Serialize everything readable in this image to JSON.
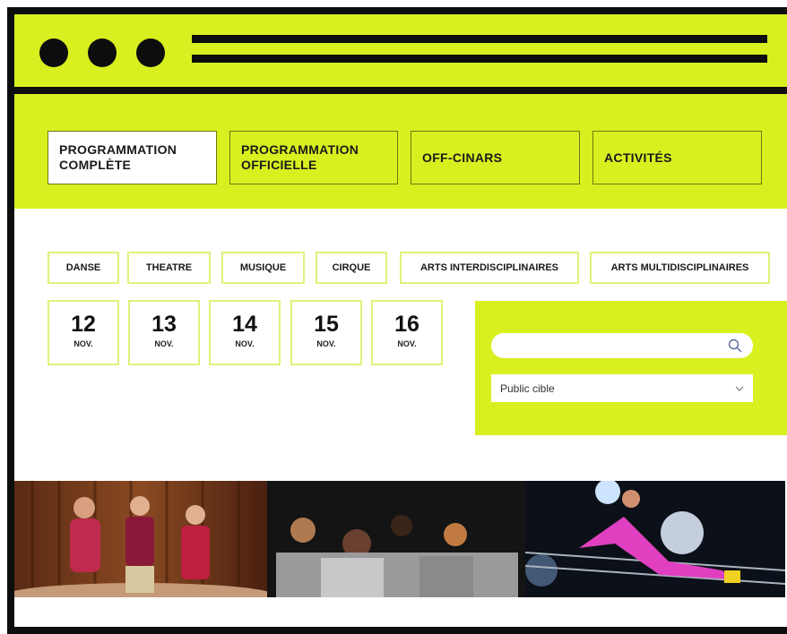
{
  "nav": {
    "tabs": [
      {
        "label": "PROGRAMMATION COMPLÈTE",
        "active": true
      },
      {
        "label": "PROGRAMMATION OFFICIELLE",
        "active": false
      },
      {
        "label": "OFF-CINARS",
        "active": false
      },
      {
        "label": "ACTIVITÉS",
        "active": false
      }
    ]
  },
  "categories": [
    "DANSE",
    "THEATRE",
    "MUSIQUE",
    "CIRQUE",
    "ARTS INTERDISCIPLINAIRES",
    "ARTS MULTIDISCIPLINAIRES"
  ],
  "dates": [
    {
      "day": "12",
      "month": "NOV."
    },
    {
      "day": "13",
      "month": "NOV."
    },
    {
      "day": "14",
      "month": "NOV."
    },
    {
      "day": "15",
      "month": "NOV."
    },
    {
      "day": "16",
      "month": "NOV."
    }
  ],
  "filters": {
    "search_value": "",
    "audience_select": "Public cible"
  },
  "icons": {
    "search": "search-icon",
    "dropdown": "chevron-down-icon"
  },
  "colors": {
    "accent": "#d8f020",
    "frame": "#0d0d0d",
    "outline": "#e0f27a"
  }
}
